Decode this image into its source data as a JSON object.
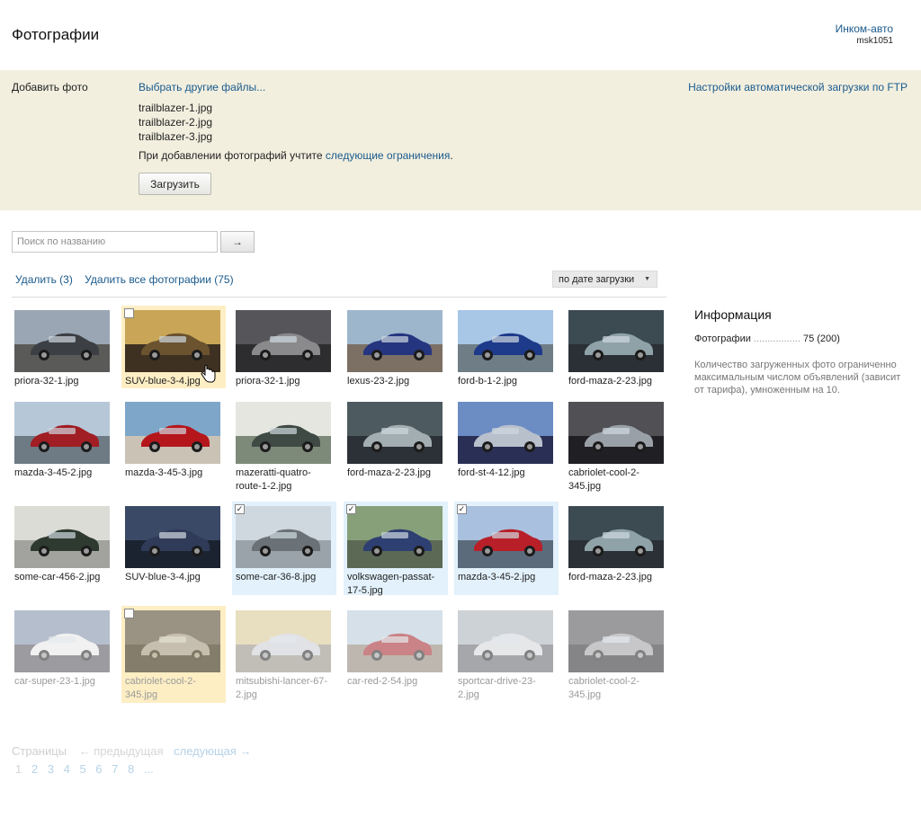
{
  "header": {
    "title": "Фотографии",
    "company": "Инком-авто",
    "login": "msk1051"
  },
  "upload": {
    "label": "Добавить фото",
    "choose_link": "Выбрать другие файлы...",
    "ftp_link": "Настройки автоматической загрузки по FTP",
    "files": [
      "trailblazer-1.jpg",
      "trailblazer-2.jpg",
      "trailblazer-3.jpg"
    ],
    "note_prefix": "При добавлении фотографий учтите ",
    "note_link": "следующие ограничения",
    "note_suffix": ".",
    "button": "Загрузить"
  },
  "search": {
    "placeholder": "Поиск по названию",
    "button": "→"
  },
  "actions": {
    "delete_selected": "Удалить (3)",
    "delete_all": "Удалить все фотографии (75)",
    "sort": "по дате загрузки"
  },
  "photos": [
    {
      "name": "priora-32-1.jpg",
      "selected": false,
      "faded": false
    },
    {
      "name": "SUV-blue-3-4.jpg",
      "selected": false,
      "faded": false,
      "hover": true
    },
    {
      "name": "priora-32-1.jpg",
      "selected": false,
      "faded": false
    },
    {
      "name": "lexus-23-2.jpg",
      "selected": false,
      "faded": false
    },
    {
      "name": "ford-b-1-2.jpg",
      "selected": false,
      "faded": false
    },
    {
      "name": "ford-maza-2-23.jpg",
      "selected": false,
      "faded": false
    },
    {
      "name": "mazda-3-45-2.jpg",
      "selected": false,
      "faded": false
    },
    {
      "name": "mazda-3-45-3.jpg",
      "selected": false,
      "faded": false
    },
    {
      "name": "mazeratti-quatro-route-1-2.jpg",
      "selected": false,
      "faded": false
    },
    {
      "name": "ford-maza-2-23.jpg",
      "selected": false,
      "faded": false
    },
    {
      "name": "ford-st-4-12.jpg",
      "selected": false,
      "faded": false
    },
    {
      "name": "cabriolet-cool-2-345.jpg",
      "selected": false,
      "faded": false
    },
    {
      "name": "some-car-456-2.jpg",
      "selected": false,
      "faded": false
    },
    {
      "name": "SUV-blue-3-4.jpg",
      "selected": false,
      "faded": false
    },
    {
      "name": "some-car-36-8.jpg",
      "selected": true,
      "faded": false
    },
    {
      "name": "volkswagen-passat-17-5.jpg",
      "selected": true,
      "faded": false
    },
    {
      "name": "mazda-3-45-2.jpg",
      "selected": true,
      "faded": false
    },
    {
      "name": "ford-maza-2-23.jpg",
      "selected": false,
      "faded": false
    },
    {
      "name": "car-super-23-1.jpg",
      "selected": false,
      "faded": true
    },
    {
      "name": "cabriolet-cool-2-345.jpg",
      "selected": false,
      "faded": true,
      "hover": true
    },
    {
      "name": "mitsubishi-lancer-67-2.jpg",
      "selected": false,
      "faded": true
    },
    {
      "name": "car-red-2-54.jpg",
      "selected": false,
      "faded": true
    },
    {
      "name": "sportcar-drive-23-2.jpg",
      "selected": false,
      "faded": true
    },
    {
      "name": "cabriolet-cool-2-345.jpg",
      "selected": false,
      "faded": true
    }
  ],
  "info": {
    "title": "Информация",
    "photos_label": "Фотографии",
    "photos_value": "75 (200)",
    "note": "Количество загруженных фото ограниченно максимальным числом объявлений (зависит от тарифа), умноженным на 10."
  },
  "pager": {
    "label": "Страницы",
    "prev": "← предыдущая",
    "next": "следующая →",
    "pages": [
      "1",
      "2",
      "3",
      "4",
      "5",
      "6",
      "7",
      "8",
      "..."
    ],
    "current": "1"
  },
  "colors": {
    "link": "#1a5a8c",
    "upload_bg": "#f2efdf",
    "hover_tile": "#fdeec4",
    "selected_tile": "#e2f1fb"
  }
}
